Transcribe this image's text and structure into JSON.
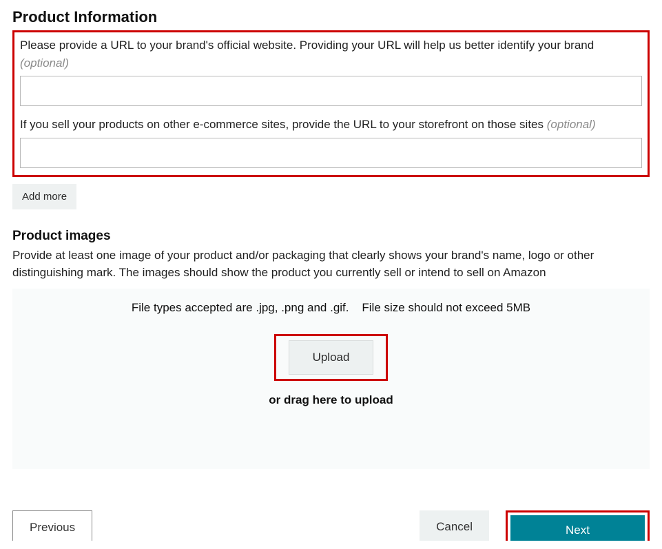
{
  "heading": "Product Information",
  "field1": {
    "label": "Please provide a URL to your brand's official website. Providing your URL will help us better identify your brand",
    "optional": "(optional)",
    "value": ""
  },
  "field2": {
    "label": "If you sell your products on other e-commerce sites, provide the URL to your storefront on those sites",
    "optional": "(optional)",
    "value": ""
  },
  "add_more_label": "Add more",
  "images_heading": "Product images",
  "images_description": "Provide at least one image of your product and/or packaging that clearly shows your brand's name, logo or other distinguishing mark. The images should show the product you currently sell or intend to sell on Amazon",
  "file_hint": "File types accepted are .jpg, .png and .gif.    File size should not exceed 5MB",
  "upload_label": "Upload",
  "drag_hint": "or drag here to upload",
  "previous_label": "Previous",
  "cancel_label": "Cancel",
  "next_label": "Next"
}
